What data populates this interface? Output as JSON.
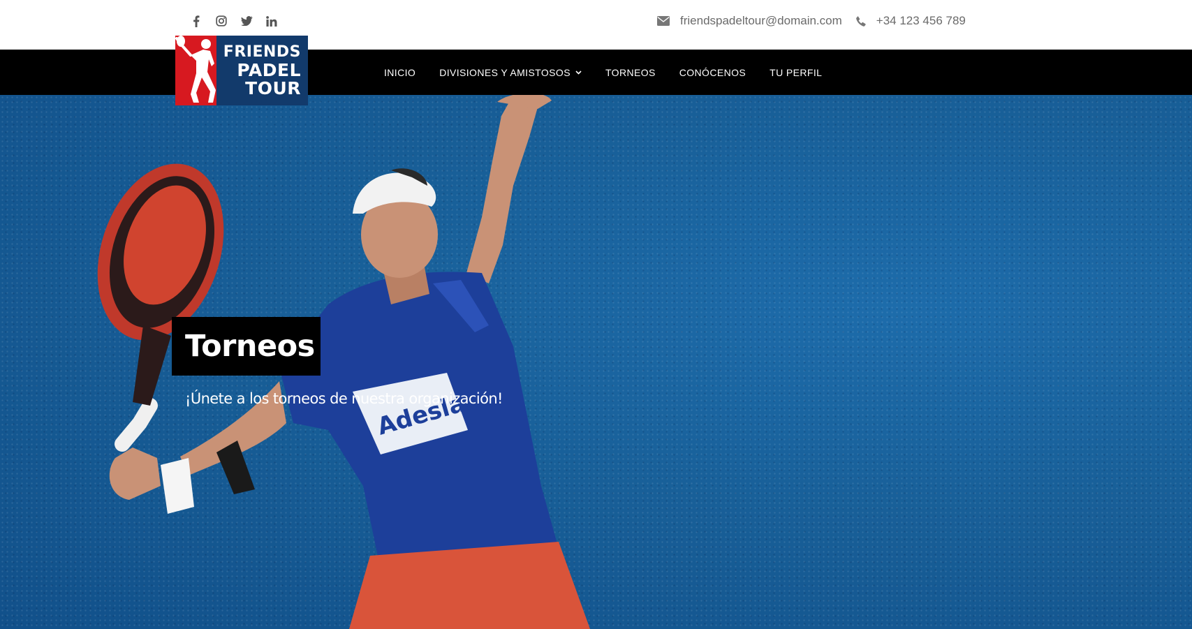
{
  "colors": {
    "accent_red": "#d71920",
    "brand_blue": "#123a6b",
    "navbar_bg": "#000000",
    "hero_blue": "#185f98",
    "contact_text": "#6a6a6a"
  },
  "social": [
    {
      "name": "facebook",
      "icon": "facebook-icon"
    },
    {
      "name": "instagram",
      "icon": "instagram-icon"
    },
    {
      "name": "twitter",
      "icon": "twitter-icon"
    },
    {
      "name": "linkedin",
      "icon": "linkedin-icon"
    }
  ],
  "contact": {
    "email": "friendspadeltour@domain.com",
    "email_icon": "envelope-icon",
    "phone": "+34 123 456 789",
    "phone_icon": "phone-icon"
  },
  "logo": {
    "line1": "FRIENDS",
    "line2": "PADEL",
    "line3": "TOUR"
  },
  "nav": {
    "items": [
      {
        "label": "INICIO"
      },
      {
        "label": "DIVISIONES Y AMISTOSOS",
        "has_dropdown": true
      },
      {
        "label": "TORNEOS"
      },
      {
        "label": "CONÓCENOS"
      },
      {
        "label": "TU PERFIL"
      }
    ]
  },
  "hero": {
    "title": "Torneos",
    "subtitle": "¡Únete a los torneos de nuestra organización!",
    "image": "padel-player-photo"
  }
}
